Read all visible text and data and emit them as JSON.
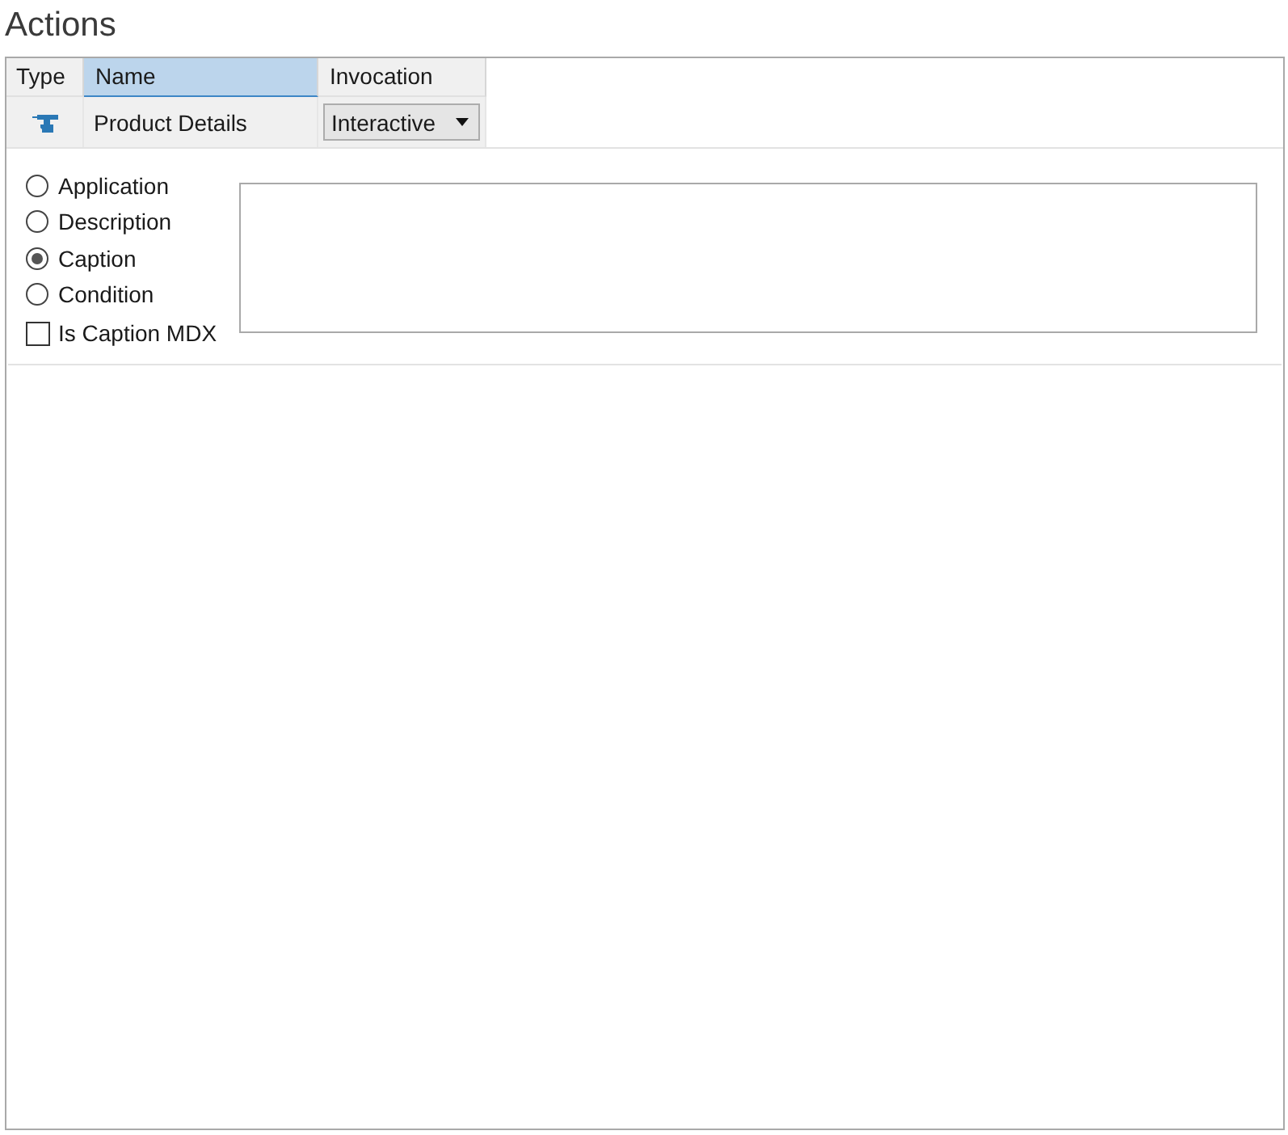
{
  "title": "Actions",
  "grid": {
    "columns": [
      {
        "label": "Type",
        "selected": false
      },
      {
        "label": "Name",
        "selected": true
      },
      {
        "label": "Invocation",
        "selected": false
      }
    ],
    "rows": [
      {
        "name": "Product Details",
        "invocation": "Interactive"
      }
    ]
  },
  "options": [
    {
      "label": "Application",
      "selected": false
    },
    {
      "label": "Description",
      "selected": false
    },
    {
      "label": "Caption",
      "selected": true
    },
    {
      "label": "Condition",
      "selected": false
    }
  ],
  "caption_mdx": {
    "label": "Is Caption MDX",
    "checked": false
  }
}
